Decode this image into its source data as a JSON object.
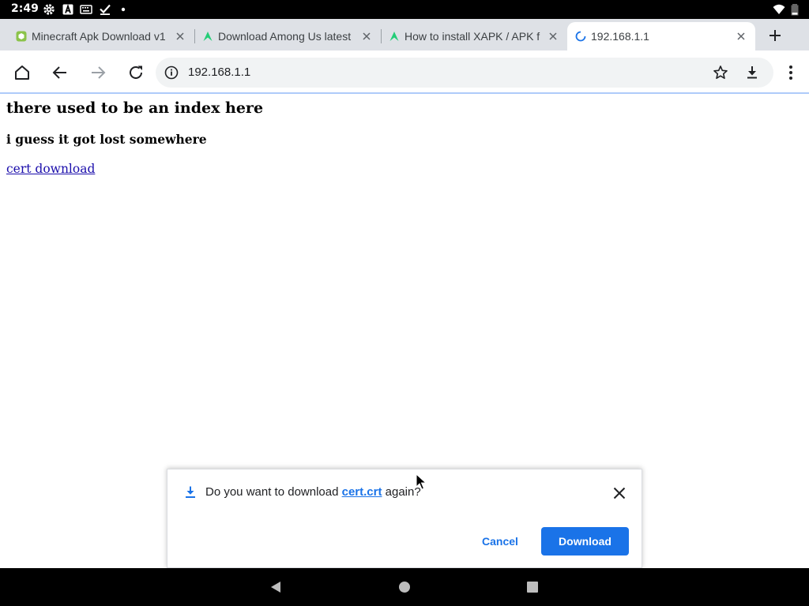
{
  "status_bar": {
    "time": "2:49",
    "icons": [
      "gear-icon",
      "font-a-icon",
      "keyboard-icon",
      "checkmark-icon",
      "dot-icon",
      "wifi-icon",
      "battery-icon"
    ]
  },
  "tabs": [
    {
      "title": "Minecraft Apk Download v1",
      "favicon": "green-cube-icon",
      "active": false
    },
    {
      "title": "Download Among Us latest",
      "favicon": "apkpure-icon",
      "active": false
    },
    {
      "title": "How to install XAPK / APK f",
      "favicon": "apkpure-icon",
      "active": false
    },
    {
      "title": "192.168.1.1",
      "favicon": "loading-spinner-icon",
      "active": true
    }
  ],
  "toolbar": {
    "url": "192.168.1.1"
  },
  "page": {
    "heading": "there used to be an index here",
    "subheading": "i guess it got lost somewhere",
    "link": "cert download"
  },
  "download_prompt": {
    "message_before": "Do you want to download ",
    "filename": "cert.crt",
    "message_after": " again?",
    "cancel_label": "Cancel",
    "download_label": "Download"
  },
  "colors": {
    "accent": "#1a73e8",
    "link": "#1a0dab",
    "tabstrip": "#dee1e6",
    "omnibox": "#f1f3f4"
  }
}
